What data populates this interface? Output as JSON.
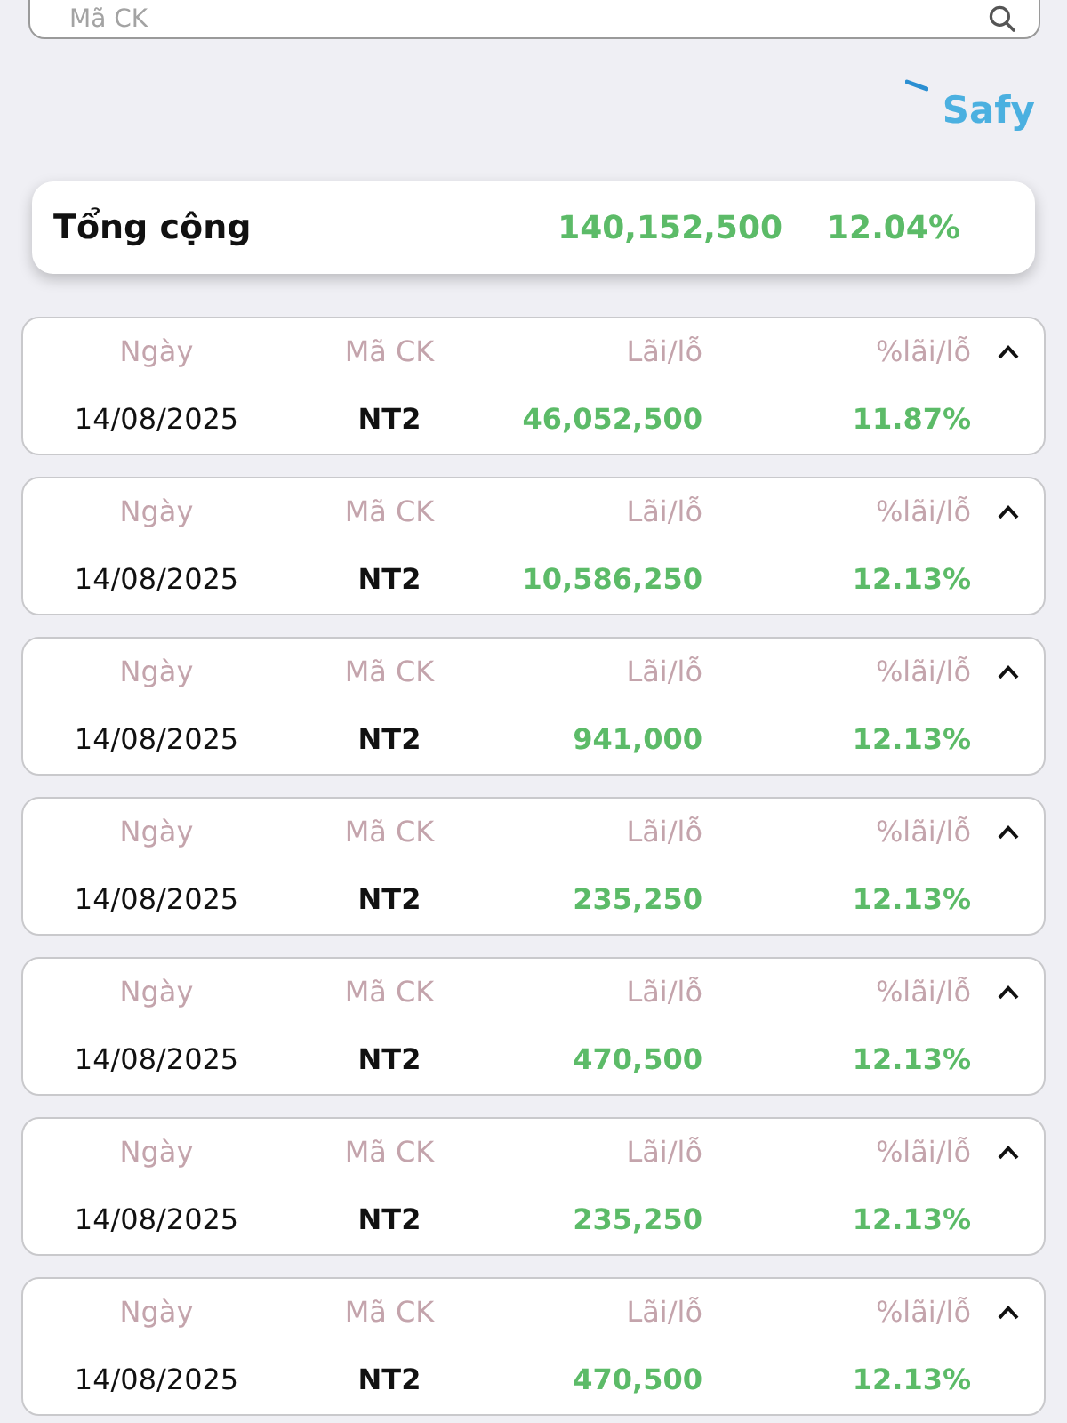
{
  "search": {
    "placeholder": "Mã CK"
  },
  "logo": {
    "text": "Safy"
  },
  "total": {
    "label": "Tổng cộng",
    "amount": "140,152,500",
    "percent": "12.04%"
  },
  "entries": [
    {
      "date_label": "Ngày",
      "code_label": "Mã CK",
      "profit_label": "Lãi/lỗ",
      "percent_label": "%lãi/lỗ",
      "date": "14/08/2025",
      "code": "NT2",
      "profit": "46,052,500",
      "percent": "11.87%"
    },
    {
      "date_label": "Ngày",
      "code_label": "Mã CK",
      "profit_label": "Lãi/lỗ",
      "percent_label": "%lãi/lỗ",
      "date": "14/08/2025",
      "code": "NT2",
      "profit": "10,586,250",
      "percent": "12.13%"
    },
    {
      "date_label": "Ngày",
      "code_label": "Mã CK",
      "profit_label": "Lãi/lỗ",
      "percent_label": "%lãi/lỗ",
      "date": "14/08/2025",
      "code": "NT2",
      "profit": "941,000",
      "percent": "12.13%"
    },
    {
      "date_label": "Ngày",
      "code_label": "Mã CK",
      "profit_label": "Lãi/lỗ",
      "percent_label": "%lãi/lỗ",
      "date": "14/08/2025",
      "code": "NT2",
      "profit": "235,250",
      "percent": "12.13%"
    },
    {
      "date_label": "Ngày",
      "code_label": "Mã CK",
      "profit_label": "Lãi/lỗ",
      "percent_label": "%lãi/lỗ",
      "date": "14/08/2025",
      "code": "NT2",
      "profit": "470,500",
      "percent": "12.13%"
    },
    {
      "date_label": "Ngày",
      "code_label": "Mã CK",
      "profit_label": "Lãi/lỗ",
      "percent_label": "%lãi/lỗ",
      "date": "14/08/2025",
      "code": "NT2",
      "profit": "235,250",
      "percent": "12.13%"
    },
    {
      "date_label": "Ngày",
      "code_label": "Mã CK",
      "profit_label": "Lãi/lỗ",
      "percent_label": "%lãi/lỗ",
      "date": "14/08/2025",
      "code": "NT2",
      "profit": "470,500",
      "percent": "12.13%"
    }
  ]
}
